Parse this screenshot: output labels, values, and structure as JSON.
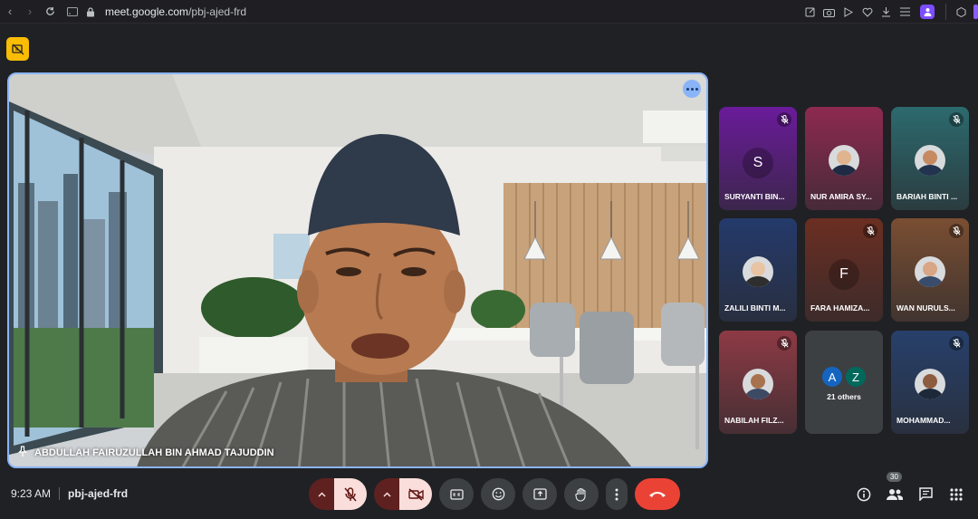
{
  "browser": {
    "url_host": "meet.google.com",
    "url_path": "/pbj-ajed-frd"
  },
  "main_tile": {
    "name": "ABDULLAH FAIRUZULLAH BIN AHMAD TAJUDDIN"
  },
  "participants": [
    {
      "name": "SURYANTI BIN...",
      "avatar_letter": "S",
      "bg": "#6a1b9a",
      "muted": true
    },
    {
      "name": "NUR AMIRA SY...",
      "avatar_letter": "",
      "bg": "#8e2a4f",
      "muted": false
    },
    {
      "name": "BARIAH BINTI ...",
      "avatar_letter": "",
      "bg": "#2c6a6e",
      "muted": true
    },
    {
      "name": "ZALILI BINTI M...",
      "avatar_letter": "",
      "bg": "#243a6b",
      "muted": false
    },
    {
      "name": "FARA HAMIZA...",
      "avatar_letter": "F",
      "bg": "#6b2e22",
      "muted": true
    },
    {
      "name": "WAN NURULS...",
      "avatar_letter": "",
      "bg": "#7a4e32",
      "muted": true
    },
    {
      "name": "NABILAH FILZ...",
      "avatar_letter": "",
      "bg": "#8d3a44",
      "muted": true
    },
    {
      "name": "MOHAMMAD...",
      "avatar_letter": "",
      "bg": "#27406b",
      "muted": true
    }
  ],
  "others": {
    "avatars": [
      "A",
      "Z"
    ],
    "label": "21 others"
  },
  "bottom": {
    "time": "9:23 AM",
    "meeting_code": "pbj-ajed-frd",
    "people_count": "30"
  }
}
